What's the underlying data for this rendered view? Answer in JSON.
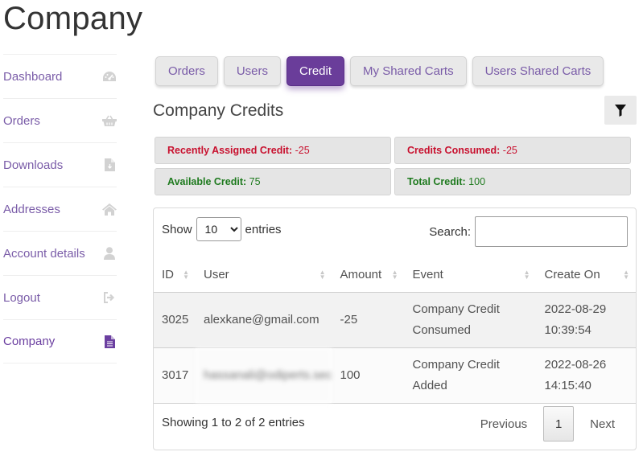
{
  "page": {
    "title": "Company"
  },
  "sidebar": {
    "items": [
      {
        "label": "Dashboard",
        "icon": "gauge-icon"
      },
      {
        "label": "Orders",
        "icon": "basket-icon"
      },
      {
        "label": "Downloads",
        "icon": "file-download-icon"
      },
      {
        "label": "Addresses",
        "icon": "home-icon"
      },
      {
        "label": "Account details",
        "icon": "user-icon"
      },
      {
        "label": "Logout",
        "icon": "sign-out-icon"
      },
      {
        "label": "Company",
        "icon": "document-icon",
        "active": true
      }
    ]
  },
  "tabs": [
    {
      "label": "Orders"
    },
    {
      "label": "Users"
    },
    {
      "label": "Credit",
      "active": true
    },
    {
      "label": "My Shared Carts"
    },
    {
      "label": "Users Shared Carts"
    }
  ],
  "section": {
    "title": "Company Credits",
    "filter_icon": "filter-icon"
  },
  "stats": {
    "recently_assigned": {
      "label": "Recently Assigned Credit:",
      "value": "-25"
    },
    "consumed": {
      "label": "Credits Consumed:",
      "value": "-25"
    },
    "available": {
      "label": "Available Credit:",
      "value": "75"
    },
    "total": {
      "label": "Total Credit:",
      "value": "100"
    }
  },
  "table": {
    "show_label": "Show",
    "entries_label": "entries",
    "page_length": "10",
    "search_label": "Search:",
    "search_value": "",
    "columns": [
      "ID",
      "User",
      "Amount",
      "Event",
      "Create On"
    ],
    "rows": [
      {
        "id": "3025",
        "user": "alexkane@gmail.com",
        "amount": "-25",
        "event_1": "Company Credit",
        "event_2": "Consumed",
        "date": "2022-08-29",
        "time": "10:39:54"
      },
      {
        "id": "3017",
        "user": "hassanali@odiperts.sec",
        "amount": "100",
        "event_1": "Company Credit",
        "event_2": "Added",
        "date": "2022-08-26",
        "time": "14:15:40"
      }
    ],
    "info": "Showing 1 to 2 of 2 entries",
    "paging": {
      "previous": "Previous",
      "current": "1",
      "next": "Next"
    }
  },
  "colors": {
    "accent": "#6a3d9a",
    "link": "#7a5ca8",
    "negative": "#c8102e",
    "positive": "#1e7a1e"
  }
}
